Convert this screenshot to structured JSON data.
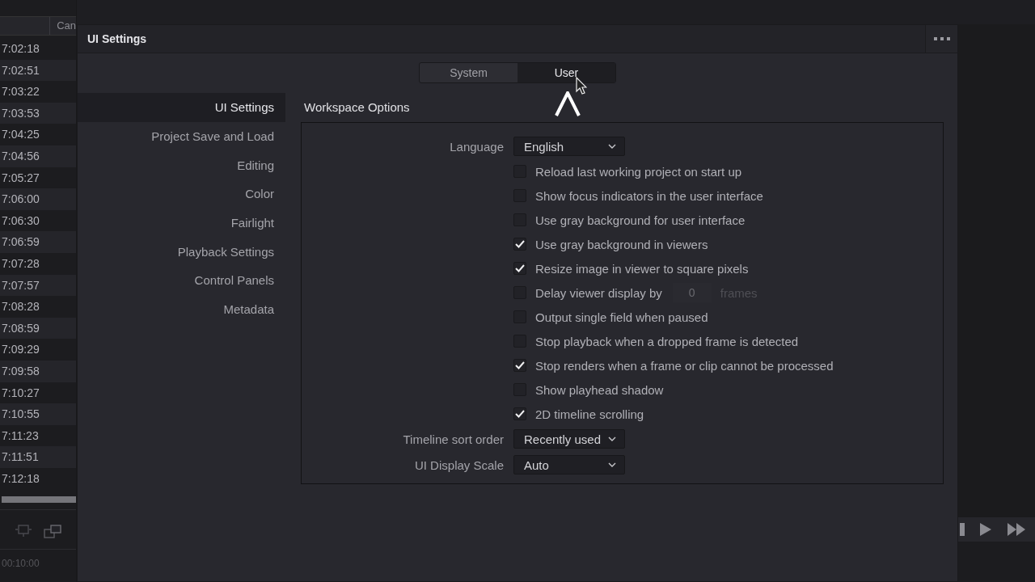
{
  "background_app": {
    "column_header": "Can",
    "timecodes": [
      "7:02:18",
      "7:02:51",
      "7:03:22",
      "7:03:53",
      "7:04:25",
      "7:04:56",
      "7:05:27",
      "7:06:00",
      "7:06:30",
      "7:06:59",
      "7:07:28",
      "7:07:57",
      "7:08:28",
      "7:08:59",
      "7:09:29",
      "7:09:58",
      "7:10:27",
      "7:10:55",
      "7:11:23",
      "7:11:51",
      "7:12:18"
    ],
    "timecode_readout": "00:10:00"
  },
  "dialog": {
    "title": "UI Settings",
    "tabs": [
      {
        "label": "System",
        "selected": false
      },
      {
        "label": "User",
        "selected": true
      }
    ],
    "nav": [
      {
        "label": "UI Settings",
        "selected": true
      },
      {
        "label": "Project Save and Load",
        "selected": false
      },
      {
        "label": "Editing",
        "selected": false
      },
      {
        "label": "Color",
        "selected": false
      },
      {
        "label": "Fairlight",
        "selected": false
      },
      {
        "label": "Playback Settings",
        "selected": false
      },
      {
        "label": "Control Panels",
        "selected": false
      },
      {
        "label": "Metadata",
        "selected": false
      }
    ],
    "section_title": "Workspace Options",
    "rows": [
      {
        "kind": "select",
        "label": "Language",
        "value": "English"
      },
      {
        "kind": "checkbox",
        "label": "Reload last working project on start up",
        "checked": false
      },
      {
        "kind": "checkbox",
        "label": "Show focus indicators in the user interface",
        "checked": false
      },
      {
        "kind": "checkbox",
        "label": "Use gray background for user interface",
        "checked": false
      },
      {
        "kind": "checkbox",
        "label": "Use gray background in viewers",
        "checked": true
      },
      {
        "kind": "checkbox",
        "label": "Resize image in viewer to square pixels",
        "checked": true
      },
      {
        "kind": "checkbox",
        "label": "Delay viewer display by",
        "checked": false,
        "field": {
          "value": "0",
          "unit": "frames"
        }
      },
      {
        "kind": "checkbox",
        "label": "Output single field when paused",
        "checked": false
      },
      {
        "kind": "checkbox",
        "label": "Stop playback when a dropped frame is detected",
        "checked": false
      },
      {
        "kind": "checkbox",
        "label": "Stop renders when a frame or clip cannot be processed",
        "checked": true
      },
      {
        "kind": "checkbox",
        "label": "Show playhead shadow",
        "checked": false
      },
      {
        "kind": "checkbox",
        "label": "2D timeline scrolling",
        "checked": true
      },
      {
        "kind": "select",
        "label": "Timeline sort order",
        "value": "Recently used"
      },
      {
        "kind": "select",
        "label": "UI Display Scale",
        "value": "Auto"
      }
    ]
  }
}
